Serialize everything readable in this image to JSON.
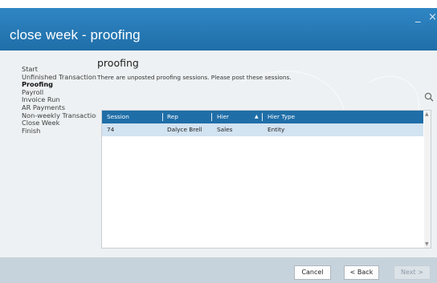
{
  "window": {
    "title": "close week - proofing",
    "minimize_glyph": "_",
    "close_glyph": "×"
  },
  "wizard_steps": [
    {
      "label": "Start",
      "active": false
    },
    {
      "label": "Unfinished Transactions",
      "active": false
    },
    {
      "label": "Proofing",
      "active": true
    },
    {
      "label": "Payroll",
      "active": false
    },
    {
      "label": "Invoice Run",
      "active": false
    },
    {
      "label": "AR Payments",
      "active": false
    },
    {
      "label": "Non-weekly Transactions",
      "active": false
    },
    {
      "label": "Close Week",
      "active": false
    },
    {
      "label": "Finish",
      "active": false
    }
  ],
  "page": {
    "heading": "proofing",
    "message": "There are unposted proofing sessions.  Please post these sessions."
  },
  "grid": {
    "columns": [
      "Session",
      "Rep",
      "Hier",
      "Hier Type"
    ],
    "sorted_column": "Hier",
    "sort_direction": "ascending",
    "rows": [
      {
        "session": "74",
        "rep": "Dalyce Brell",
        "hier": "Sales",
        "hier_type": "Entity"
      }
    ]
  },
  "icons": {
    "search": "magnifier-icon",
    "sort": "sort-ascending-icon",
    "current_step": "current-step-arrow-icon"
  },
  "buttons": {
    "cancel": "Cancel",
    "back": "< Back",
    "next": "Next >"
  },
  "colors": {
    "titlebar": "#2f86c4",
    "grid_header": "#1f6ea8",
    "selected_row": "#d2e3f1",
    "footer": "#c7d3dc"
  }
}
